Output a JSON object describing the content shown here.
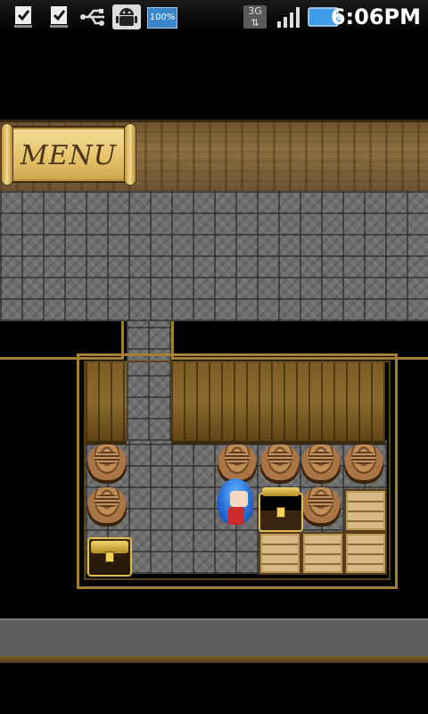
{
  "status_bar": {
    "battery_percent": "100%",
    "network": "3G",
    "time": "6:06PM",
    "icons": [
      "checklist-icon",
      "checklist-icon",
      "usb-icon",
      "android-debug-icon",
      "battery-icon",
      "signal-icon"
    ]
  },
  "game": {
    "menu_label": "MENU"
  }
}
